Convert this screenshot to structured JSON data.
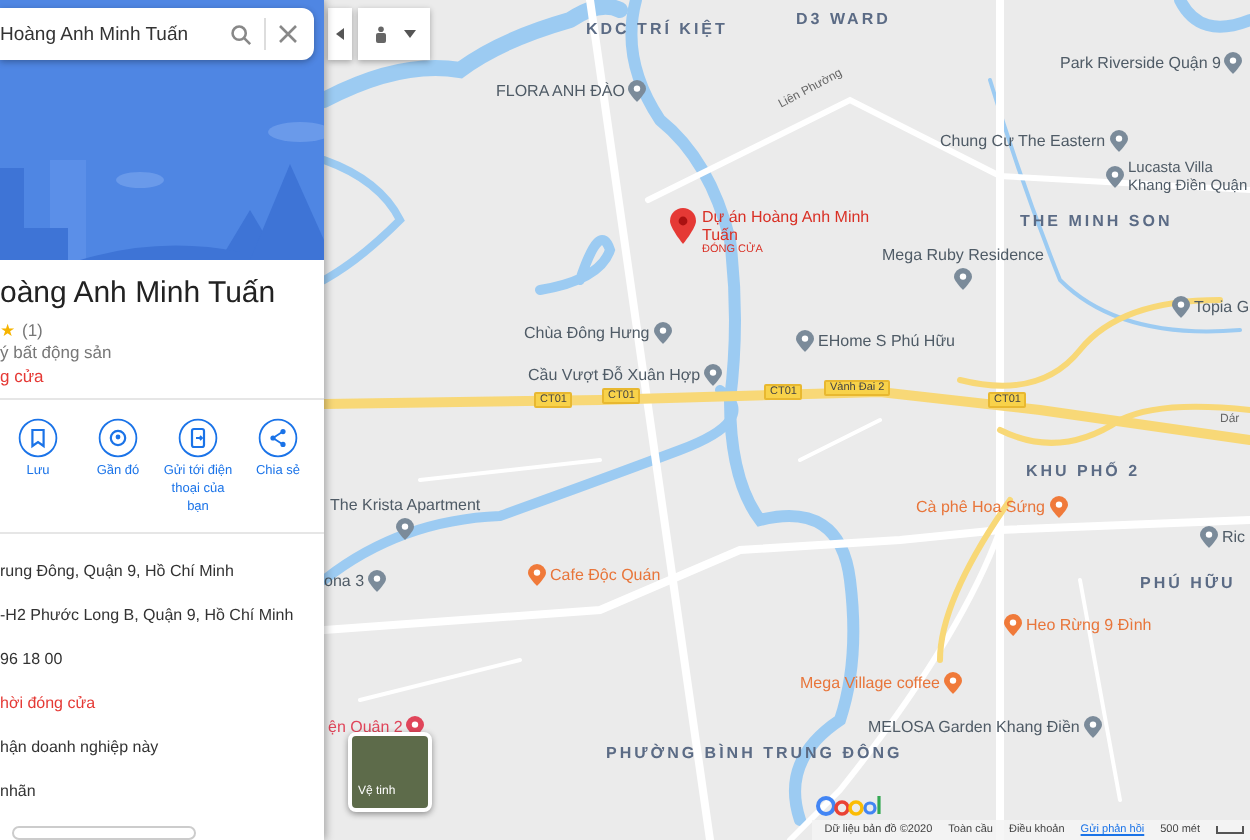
{
  "search": {
    "value": "Hoàng Anh Minh Tuấn"
  },
  "place": {
    "title": "oàng Anh Minh Tuấn",
    "star": "★",
    "review_count": "(1)",
    "category": "ý bất động sản",
    "status": "g cửa"
  },
  "actions": [
    {
      "kind": "save",
      "label": "Lưu"
    },
    {
      "kind": "nearby",
      "label": "Gần đó"
    },
    {
      "kind": "phone",
      "label": "Gửi tới điện thoại của bạn"
    },
    {
      "kind": "share",
      "label": "Chia sẻ"
    }
  ],
  "details": [
    {
      "text": "rung Đông, Quận 9, Hồ Chí Minh",
      "alert": false
    },
    {
      "text": "-H2 Phước Long B, Quận 9, Hồ Chí Minh",
      "alert": false
    },
    {
      "text": "96 18 00",
      "alert": false
    },
    {
      "text": "hời đóng cửa",
      "alert": true
    },
    {
      "text": "hận doanh nghiệp này",
      "alert": false
    },
    {
      "text": "nhãn",
      "alert": false
    }
  ],
  "map": {
    "labels": [
      {
        "kind": "area",
        "text": "KDC TRÍ KIỆT"
      },
      {
        "kind": "area",
        "text": "D3 WARD"
      },
      {
        "kind": "place",
        "text": "FLORA ANH ĐÀO"
      },
      {
        "kind": "road",
        "text": "Liên Phường"
      },
      {
        "kind": "place",
        "text": "Park Riverside Quận 9"
      },
      {
        "kind": "place",
        "text": "Chung Cư The Eastern"
      },
      {
        "kind": "place",
        "text": "Lucasta Villa Khang Điền Quận"
      },
      {
        "kind": "selected",
        "text": "Dự án Hoàng Anh Minh Tuấn",
        "note": "ĐÓNG CỬA"
      },
      {
        "kind": "area",
        "text": "THE MINH SON"
      },
      {
        "kind": "place",
        "text": "Mega Ruby Residence"
      },
      {
        "kind": "place",
        "text": "Topia G"
      },
      {
        "kind": "place",
        "text": "Chùa Đông Hưng"
      },
      {
        "kind": "place",
        "text": "EHome S Phú Hữu"
      },
      {
        "kind": "place",
        "text": "Cầu Vượt Đỗ Xuân Hợp"
      },
      {
        "kind": "shield",
        "text": "CT01"
      },
      {
        "kind": "shield",
        "text": "CT01"
      },
      {
        "kind": "shield",
        "text": "CT01"
      },
      {
        "kind": "shield",
        "text": "Vành Đai 2"
      },
      {
        "kind": "shield",
        "text": "CT01"
      },
      {
        "kind": "road",
        "text": "Dár"
      },
      {
        "kind": "area",
        "text": "KHU PHỐ 2"
      },
      {
        "kind": "place",
        "text": "The Krista Apartment"
      },
      {
        "kind": "food",
        "text": "Cà phê Hoa Sứng"
      },
      {
        "kind": "place",
        "text": "ona 3"
      },
      {
        "kind": "food",
        "text": "Cafe Độc Quán"
      },
      {
        "kind": "place",
        "text": "Ric"
      },
      {
        "kind": "area",
        "text": "PHÚ HỮU"
      },
      {
        "kind": "food",
        "text": "Heo Rừng 9 Đình"
      },
      {
        "kind": "food",
        "text": "Mega Village coffee"
      },
      {
        "kind": "place",
        "text": "MELOSA Garden Khang Điền"
      },
      {
        "kind": "area",
        "text": "PHƯỜNG BÌNH TRUNG ĐÔNG"
      },
      {
        "kind": "hospital",
        "text": "ện Quận 2"
      }
    ],
    "satellite_label": "Vệ tinh",
    "footer": [
      {
        "text": "Dữ liệu bản đồ ©2020",
        "link": false
      },
      {
        "text": "Toàn cầu",
        "link": false
      },
      {
        "text": "Điều khoản",
        "link": false
      },
      {
        "text": "Gửi phản hồi",
        "link": true
      },
      {
        "text": "500 mét",
        "link": false
      }
    ]
  }
}
